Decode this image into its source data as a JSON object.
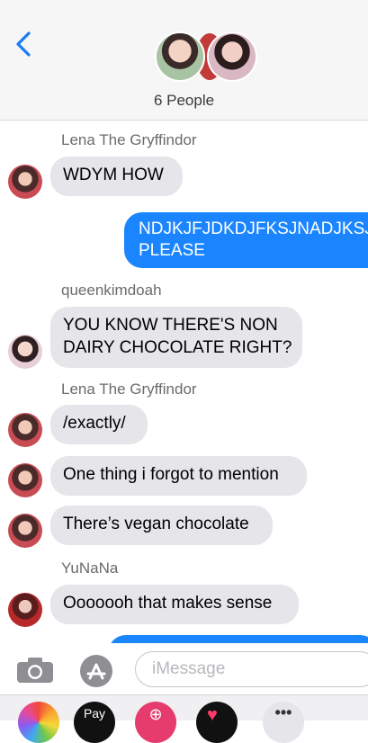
{
  "header": {
    "people_count_label": "6 People"
  },
  "messages": [
    {
      "sender": "Lena The Gryffindor",
      "text": "WDYM HOW"
    },
    {
      "outgoing": true,
      "line1": "NDJKJFJDKDJFKSJNADJKSJ",
      "line2": "PLEASE"
    },
    {
      "sender": "queenkimdoah",
      "line1": "YOU KNOW THERE'S NON",
      "line2": "DAIRY CHOCOLATE RIGHT?"
    },
    {
      "sender": "Lena The Gryffindor",
      "text": "/exactly/"
    },
    {
      "text": "One thing i forgot to mention"
    },
    {
      "text": "There’s vegan chocolate"
    },
    {
      "sender": "YuNaNa",
      "text": "Ooooooh that makes sense"
    }
  ],
  "composer": {
    "placeholder": "iMessage"
  },
  "tray": {
    "pay_label": "Pay",
    "more_label": "•••"
  },
  "colors": {
    "outgoing_bubble": "#1a85ff",
    "incoming_bubble": "#e5e5ea",
    "accent": "#1a7cf2"
  }
}
